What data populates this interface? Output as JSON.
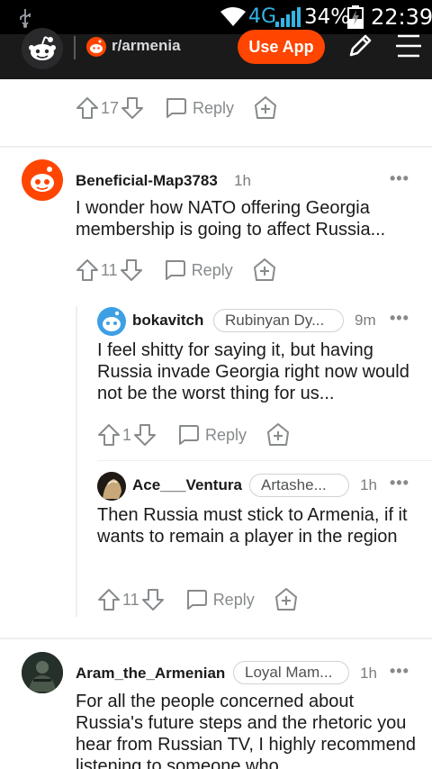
{
  "status_bar": {
    "network": "4G",
    "battery_pct": "34%",
    "time": "22:39"
  },
  "header": {
    "subreddit": "r/armenia",
    "use_app": "Use App"
  },
  "comments": [
    {
      "id": "c0",
      "score": "17",
      "reply_label": "Reply"
    },
    {
      "id": "c1",
      "username": "Beneficial-Map3783",
      "time": "1h",
      "body": "I wonder how NATO offering Georgia membership is going to affect Russia...",
      "score": "11",
      "reply_label": "Reply"
    },
    {
      "id": "c2",
      "username": "bokavitch",
      "flair": "Rubinyan Dy...",
      "time": "9m",
      "body": "I feel shitty for saying it, but having Russia invade Georgia right now would not be the worst thing for us...",
      "score": "1",
      "reply_label": "Reply"
    },
    {
      "id": "c3",
      "username": "Ace___Ventura",
      "flair": "Artashe...",
      "time": "1h",
      "body": "Then Russia must stick to Armenia, if it wants to remain a player in the region",
      "score": "11",
      "reply_label": "Reply"
    },
    {
      "id": "c4",
      "username": "Aram_the_Armenian",
      "flair": "Loyal Mam...",
      "time": "1h",
      "body": "For all the people concerned about Russia's future steps and the rhetoric you hear from Russian TV, I highly recommend listening to someone who"
    }
  ],
  "colors": {
    "accent": "#ff4500",
    "header_bg": "#1a1a1b",
    "meta_gray": "#878a8c"
  }
}
